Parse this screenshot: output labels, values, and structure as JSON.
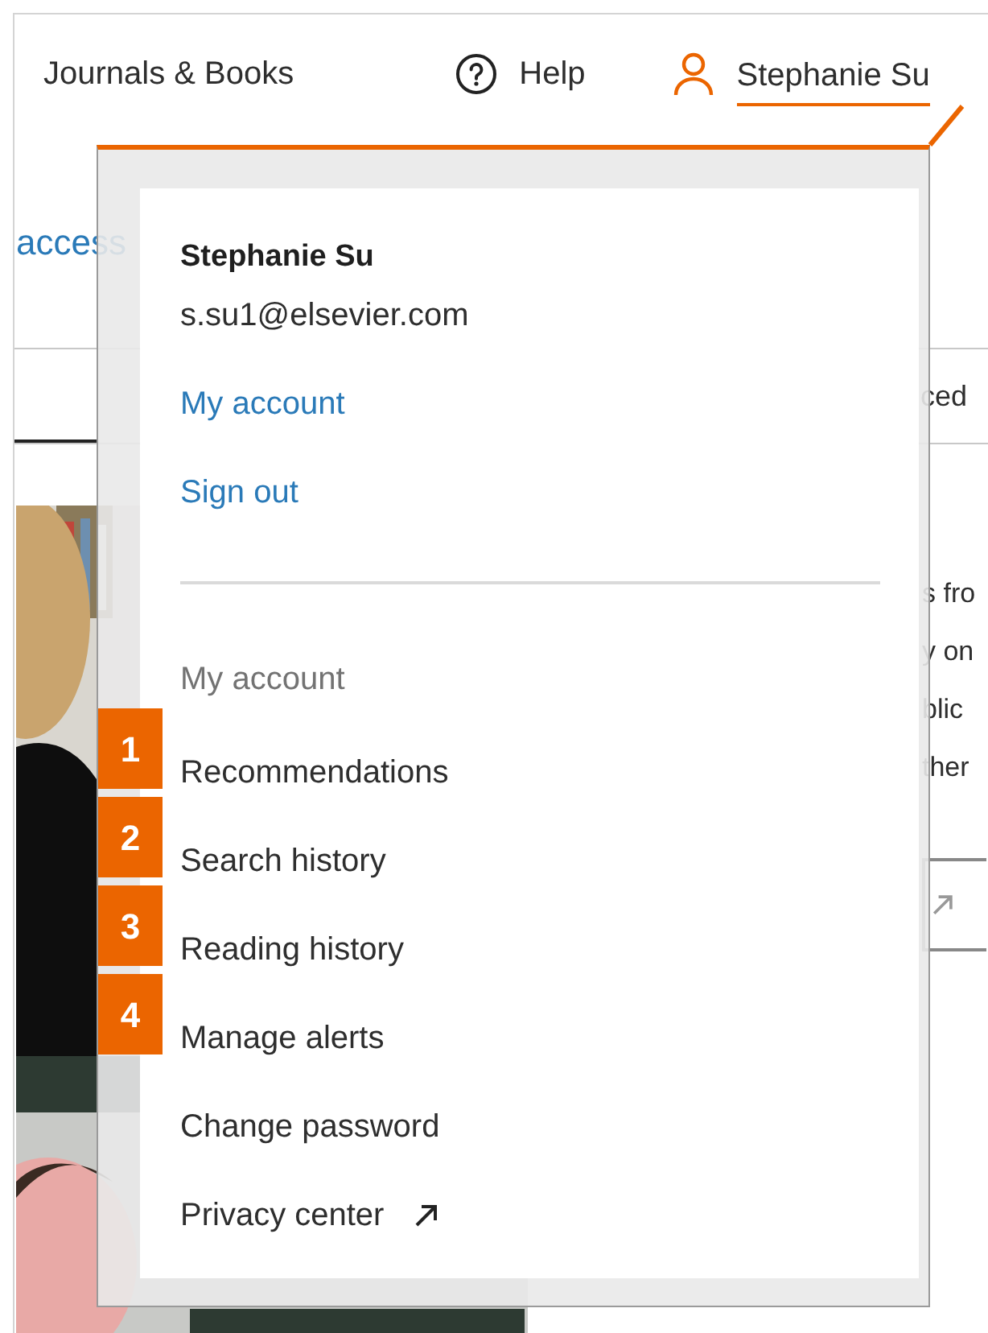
{
  "header": {
    "nav": [
      {
        "kind": "text",
        "label": "Journals & Books"
      },
      {
        "kind": "help",
        "label": "Help"
      },
      {
        "kind": "user",
        "label": "Stephanie Su",
        "expanded": true
      }
    ]
  },
  "page": {
    "link_fragment": "access",
    "tab_fragment": "ced",
    "fragments": [
      "s fro",
      "y on",
      "blic",
      "ther"
    ]
  },
  "account_menu": {
    "name": "Stephanie Su",
    "email": "s.su1@elsevier.com",
    "links": [
      "My account",
      "Sign out"
    ],
    "section_title": "My account",
    "items": [
      {
        "label": "Recommendations",
        "badge": "1",
        "external": false
      },
      {
        "label": "Search history",
        "badge": "2",
        "external": false
      },
      {
        "label": "Reading history",
        "badge": "3",
        "external": false
      },
      {
        "label": "Manage alerts",
        "badge": "4",
        "external": false
      },
      {
        "label": "Change password",
        "external": false
      },
      {
        "label": "Privacy center",
        "external": true
      }
    ]
  }
}
